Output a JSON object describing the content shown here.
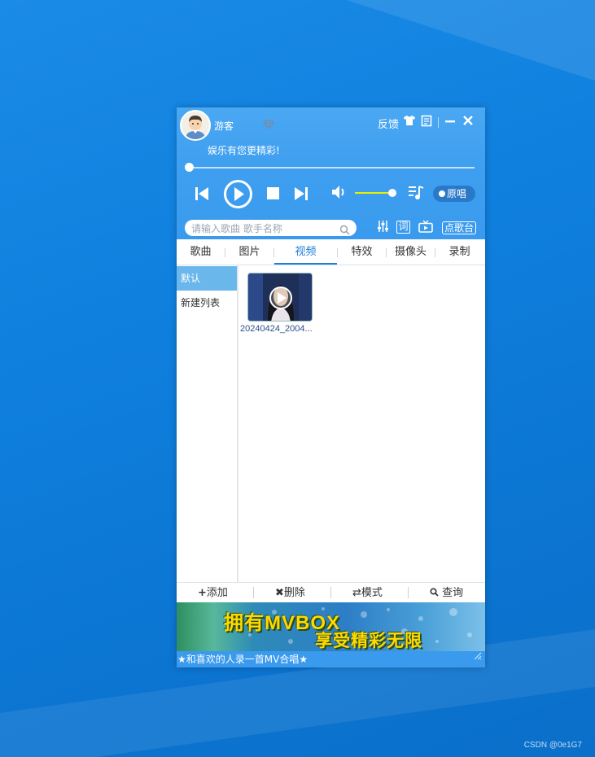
{
  "player": {
    "username": "游客",
    "tagline": "娱乐有您更精彩!",
    "feedback_label": "反馈",
    "original_label": "原唱",
    "progress": 0,
    "volume": 0.9
  },
  "search": {
    "placeholder": "请输入歌曲 歌手名称"
  },
  "toolbar": {
    "dianggetai_label": "点歌台",
    "lyrics_label": "词"
  },
  "tabs": [
    {
      "label": "歌曲"
    },
    {
      "label": "图片"
    },
    {
      "label": "视频",
      "active": true
    },
    {
      "label": "特效"
    },
    {
      "label": "摄像头"
    },
    {
      "label": "录制"
    }
  ],
  "sidebar": {
    "items": [
      {
        "label": "默认",
        "active": true
      },
      {
        "label": "新建列表"
      }
    ]
  },
  "videos": [
    {
      "name": "20240424_2004..."
    }
  ],
  "bottom_actions": [
    {
      "label": "添加",
      "icon": "plus-icon"
    },
    {
      "label": "删除",
      "icon": "x-icon"
    },
    {
      "label": "模式",
      "icon": "repeat-icon"
    },
    {
      "label": "查询",
      "icon": "search-icon"
    }
  ],
  "banner": {
    "line1": "拥有MVBOX",
    "line2": "享受精彩无限"
  },
  "footer": {
    "text": "★和喜欢的人录一首MV合唱★"
  },
  "watermark": "CSDN @0e1G7",
  "colors": {
    "accent": "#3a9aee",
    "tab_active": "#1c7fd8",
    "sidebar_active": "#6ab7ec"
  }
}
